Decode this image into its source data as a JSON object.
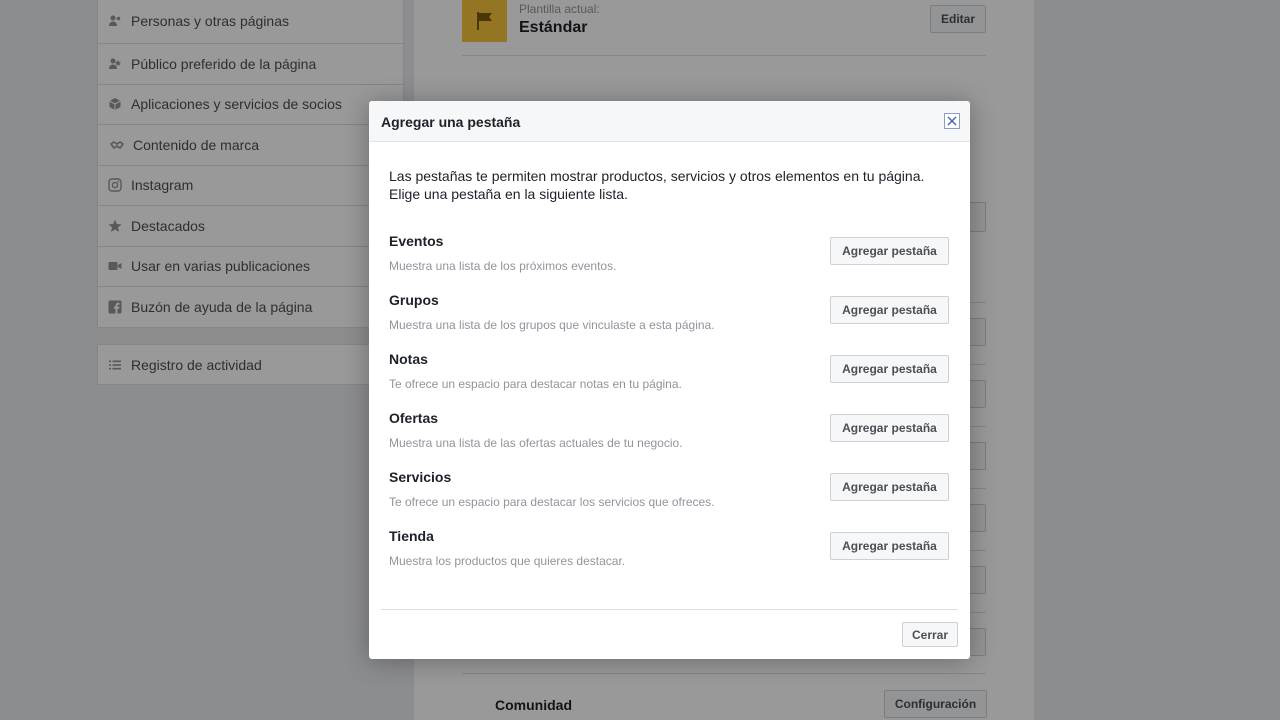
{
  "colors": {
    "accent": "#4267b2",
    "flag_background": "#f5c33b",
    "overlay": "rgba(0,0,0,0.4)"
  },
  "sidebar": {
    "items": [
      {
        "label": "Personas y otras páginas",
        "icon": "people-icon"
      },
      {
        "label": "Público preferido de la página",
        "icon": "audience-icon"
      },
      {
        "label": "Aplicaciones y servicios de socios",
        "icon": "cube-icon"
      },
      {
        "label": "Contenido de marca",
        "icon": "handshake-icon"
      },
      {
        "label": "Instagram",
        "icon": "instagram-icon"
      },
      {
        "label": "Destacados",
        "icon": "star-icon"
      },
      {
        "label": "Usar en varias publicaciones",
        "icon": "video-icon"
      },
      {
        "label": "Buzón de ayuda de la página",
        "icon": "facebook-icon"
      }
    ],
    "activity_log": {
      "label": "Registro de actividad",
      "icon": "list-icon"
    }
  },
  "main": {
    "template": {
      "caption": "Plantilla actual:",
      "name": "Estándar",
      "edit_label": "Editar"
    },
    "community": {
      "label": "Comunidad",
      "settings_label": "Configuración"
    }
  },
  "dialog": {
    "title": "Agregar una pestaña",
    "intro_line1": "Las pestañas te permiten mostrar productos, servicios y otros elementos en tu página.",
    "intro_line2": "Elige una pestaña en la siguiente lista.",
    "tabs": [
      {
        "name": "Eventos",
        "description": "Muestra una lista de los próximos eventos.",
        "button": "Agregar pestaña"
      },
      {
        "name": "Grupos",
        "description": "Muestra una lista de los grupos que vinculaste a esta página.",
        "button": "Agregar pestaña"
      },
      {
        "name": "Notas",
        "description": "Te ofrece un espacio para destacar notas en tu página.",
        "button": "Agregar pestaña"
      },
      {
        "name": "Ofertas",
        "description": "Muestra una lista de las ofertas actuales de tu negocio.",
        "button": "Agregar pestaña"
      },
      {
        "name": "Servicios",
        "description": "Te ofrece un espacio para destacar los servicios que ofreces.",
        "button": "Agregar pestaña"
      },
      {
        "name": "Tienda",
        "description": "Muestra los productos que quieres destacar.",
        "button": "Agregar pestaña"
      }
    ],
    "close_label": "Cerrar"
  }
}
